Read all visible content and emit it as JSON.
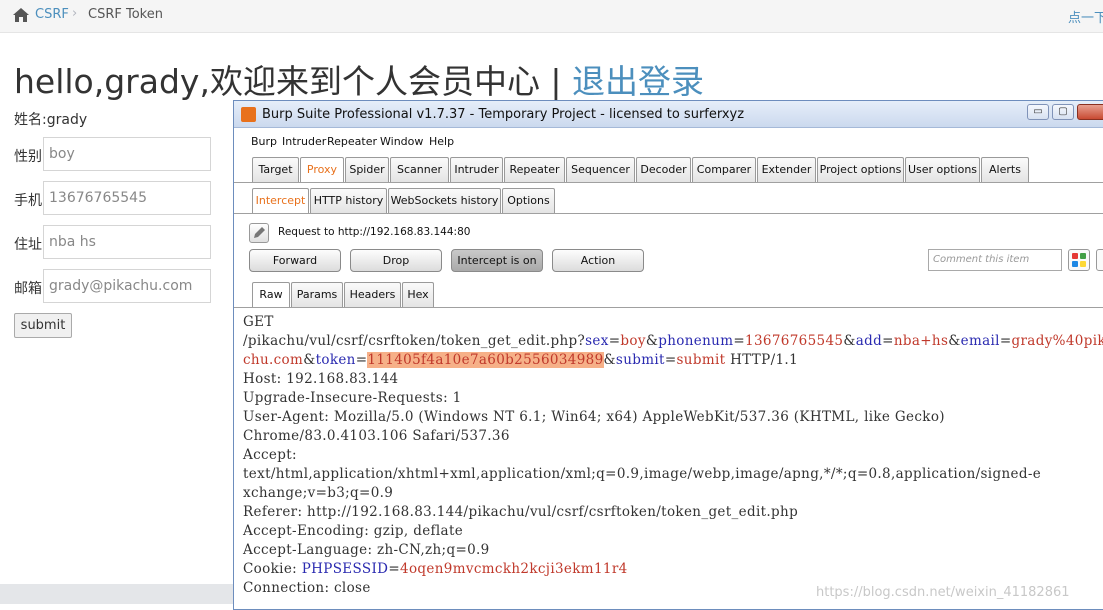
{
  "breadcrumb": {
    "crumb1": "CSRF",
    "separator": "›",
    "crumb2": "CSRF Token",
    "right_tip": "点一下"
  },
  "welcome": {
    "text": "hello,grady,欢迎来到个人会员中心 | ",
    "logout": "退出登录"
  },
  "profile": {
    "name_row": "姓名:grady",
    "fields": [
      {
        "label": "性别:",
        "value": "boy"
      },
      {
        "label": "手机:",
        "value": "13676765545"
      },
      {
        "label": "住址:",
        "value": "nba hs"
      },
      {
        "label": "邮箱:",
        "value": "grady@pikachu.com"
      }
    ],
    "submit": "submit"
  },
  "burp": {
    "title": "Burp Suite Professional v1.7.37 - Temporary Project - licensed to surferxyz",
    "window_buttons": [
      "▭",
      "▢"
    ],
    "menu": [
      "Burp",
      "Intruder",
      "Repeater",
      "Window",
      "Help"
    ],
    "main_tabs": [
      "Target",
      "Proxy",
      "Spider",
      "Scanner",
      "Intruder",
      "Repeater",
      "Sequencer",
      "Decoder",
      "Comparer",
      "Extender",
      "Project options",
      "User options",
      "Alerts"
    ],
    "active_main_tab": "Proxy",
    "proxy_tabs": [
      "Intercept",
      "HTTP history",
      "WebSockets history",
      "Options"
    ],
    "active_proxy_tab": "Intercept",
    "request_label": "Request to http://192.168.83.144:80",
    "buttons": {
      "forward": "Forward",
      "drop": "Drop",
      "intercept": "Intercept is on",
      "action": "Action"
    },
    "comment_placeholder": "Comment this item",
    "view_tabs": [
      "Raw",
      "Params",
      "Headers",
      "Hex"
    ],
    "active_view_tab": "Raw",
    "request": {
      "method": "GET",
      "path": "/pikachu/vul/csrf/csrftoken/token_get_edit.php?",
      "params": [
        {
          "name": "sex",
          "value": "boy"
        },
        {
          "name": "phonenum",
          "value": "13676765545"
        },
        {
          "name": "add",
          "value": "nba+hs"
        },
        {
          "name": "email",
          "value": "grady%40pikachu.com"
        },
        {
          "name": "token",
          "value": "111405f4a10e7a60b2556034989"
        },
        {
          "name": "submit",
          "value": "submit"
        }
      ],
      "protocol": " HTTP/1.1",
      "headers": [
        "Host: 192.168.83.144",
        "Upgrade-Insecure-Requests: 1",
        "User-Agent: Mozilla/5.0 (Windows NT 6.1; Win64; x64) AppleWebKit/537.36 (KHTML, like Gecko)",
        "Chrome/83.0.4103.106 Safari/537.36",
        "Accept:",
        "text/html,application/xhtml+xml,application/xml;q=0.9,image/webp,image/apng,*/*;q=0.8,application/signed-e",
        "xchange;v=b3;q=0.9",
        "Referer: http://192.168.83.144/pikachu/vul/csrf/csrftoken/token_get_edit.php",
        "Accept-Encoding: gzip, deflate",
        "Accept-Language: zh-CN,zh;q=0.9"
      ],
      "cookie_label": "Cookie: ",
      "cookie_name": "PHPSESSID",
      "cookie_value": "4oqen9mvcmckh2kcji3ekm11r4",
      "connection": "Connection: close"
    },
    "watermark": "https://blog.csdn.net/weixin_41182861",
    "highlight_colors": [
      "#e53935",
      "#43a047",
      "#1e88e5",
      "#fdd835"
    ]
  }
}
